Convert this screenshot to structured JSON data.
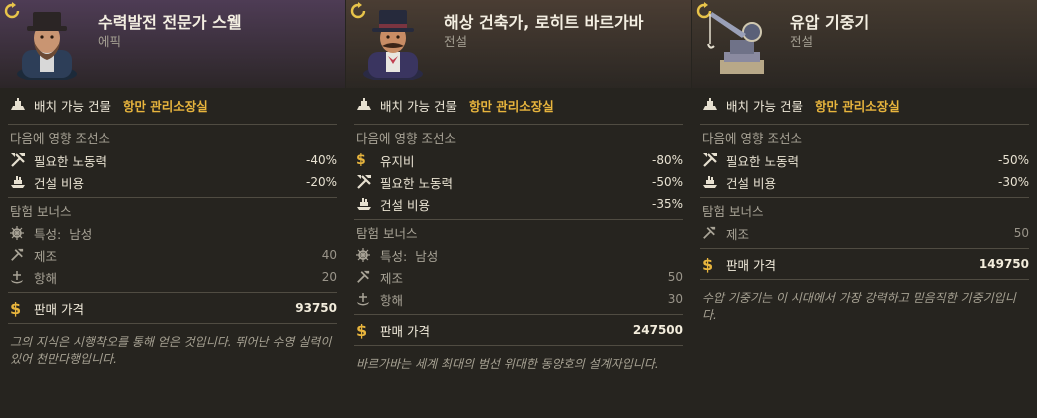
{
  "cards": [
    {
      "title": "수력발전 전문가 스웰",
      "rarity": "에픽",
      "placement_label": "배치 가능 건물",
      "placement_value": "항만 관리소장실",
      "affect_title": "다음에 영향 조선소",
      "effects": [
        {
          "icon": "tools-icon",
          "label": "필요한 노동력",
          "value": "-40%"
        },
        {
          "icon": "ship-icon",
          "label": "건설 비용",
          "value": "-20%"
        }
      ],
      "expedition_title": "탐험 보너스",
      "expedition": [
        {
          "icon": "helm-icon",
          "label": "특성:",
          "extra": "남성",
          "value": ""
        },
        {
          "icon": "tools-icon",
          "label": "제조",
          "value": "40"
        },
        {
          "icon": "anchor-ship-icon",
          "label": "항해",
          "value": "20"
        }
      ],
      "price_label": "판매 가격",
      "price_value": "93750",
      "flavor": "그의 지식은 시행착오를 통해 얻은 것입니다. 뛰어난 수영 실력이 있어 천만다행입니다."
    },
    {
      "title": "해상 건축가, 로히트 바르가바",
      "rarity": "전설",
      "placement_label": "배치 가능 건물",
      "placement_value": "항만 관리소장실",
      "affect_title": "다음에 영향 조선소",
      "effects": [
        {
          "icon": "dollar-icon",
          "label": "유지비",
          "value": "-80%"
        },
        {
          "icon": "tools-icon",
          "label": "필요한 노동력",
          "value": "-50%"
        },
        {
          "icon": "ship-icon",
          "label": "건설 비용",
          "value": "-35%"
        }
      ],
      "expedition_title": "탐험 보너스",
      "expedition": [
        {
          "icon": "helm-icon",
          "label": "특성:",
          "extra": "남성",
          "value": ""
        },
        {
          "icon": "tools-icon",
          "label": "제조",
          "value": "50"
        },
        {
          "icon": "anchor-ship-icon",
          "label": "항해",
          "value": "30"
        }
      ],
      "price_label": "판매 가격",
      "price_value": "247500",
      "flavor": "바르가바는 세계 최대의 범선 위대한 동양호의 설계자입니다."
    },
    {
      "title": "유압 기중기",
      "rarity": "전설",
      "placement_label": "배치 가능 건물",
      "placement_value": "항만 관리소장실",
      "affect_title": "다음에 영향 조선소",
      "effects": [
        {
          "icon": "tools-icon",
          "label": "필요한 노동력",
          "value": "-50%"
        },
        {
          "icon": "ship-icon",
          "label": "건설 비용",
          "value": "-30%"
        }
      ],
      "expedition_title": "탐험 보너스",
      "expedition": [
        {
          "icon": "tools-icon",
          "label": "제조",
          "value": "50"
        }
      ],
      "price_label": "판매 가격",
      "price_value": "149750",
      "flavor": "수압 기중기는 이 시대에서 가장 강력하고 믿음직한 기중기입니다."
    }
  ],
  "colors": {
    "accent": "#e8b53d",
    "background": "#26241f",
    "text": "#e6e0d0",
    "muted": "#a8a396"
  }
}
